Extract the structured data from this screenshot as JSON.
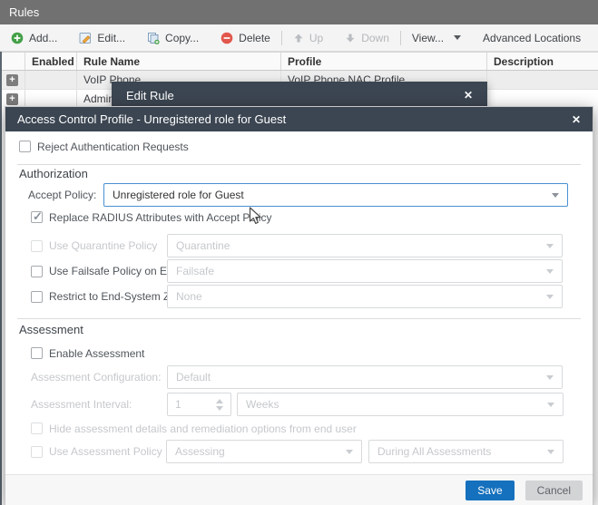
{
  "rules_panel": {
    "title": "Rules",
    "toolbar": {
      "add": "Add...",
      "edit": "Edit...",
      "copy": "Copy...",
      "delete": "Delete",
      "up": "Up",
      "down": "Down",
      "view": "View...",
      "advanced_locations": "Advanced Locations"
    },
    "table": {
      "headers": {
        "enabled": "Enabled",
        "rule_name": "Rule Name",
        "profile": "Profile",
        "description": "Description"
      },
      "rows": [
        {
          "expand": "+",
          "rule_name": "VoIP Phone",
          "profile": "VoIP Phone NAC Profile"
        },
        {
          "expand": "+",
          "rule_name": "Admini"
        }
      ]
    }
  },
  "edit_rule_dialog": {
    "title": "Edit Rule",
    "close_icon": "✕"
  },
  "dialog": {
    "title": "Access Control Profile - Unregistered role for Guest",
    "close_icon": "✕",
    "reject_auth_label": "Reject Authentication Requests",
    "authorization": {
      "heading": "Authorization",
      "accept_policy_label": "Accept Policy:",
      "accept_policy_value": "Unregistered role for Guest",
      "replace_radius_label": "Replace RADIUS Attributes with Accept Policy",
      "quarantine_label": "Use Quarantine Policy",
      "quarantine_value": "Quarantine",
      "failsafe_label": "Use Failsafe Policy on Error",
      "failsafe_value": "Failsafe",
      "zone_label": "Restrict to End-System Zone",
      "zone_value": "None"
    },
    "assessment": {
      "heading": "Assessment",
      "enable_label": "Enable Assessment",
      "config_label": "Assessment Configuration:",
      "config_value": "Default",
      "interval_label": "Assessment Interval:",
      "interval_value": "1",
      "interval_unit_value": "Weeks",
      "hide_details_label": "Hide assessment details and remediation options from end user",
      "use_policy_label": "Use Assessment Policy",
      "policy_value": "Assessing",
      "policy_when_value": "During All Assessments"
    },
    "footer": {
      "save": "Save",
      "cancel": "Cancel"
    }
  },
  "states": {
    "reject_auth": false,
    "replace_radius": true,
    "quarantine": false,
    "failsafe": false,
    "restrict_zone": false,
    "enable_assessment": false,
    "hide_details": false,
    "use_assessment_policy": false
  },
  "colors": {
    "titlebar_dark": "#3c4652",
    "accent_blue": "#1570bd",
    "focus_border": "#4a90d2"
  }
}
